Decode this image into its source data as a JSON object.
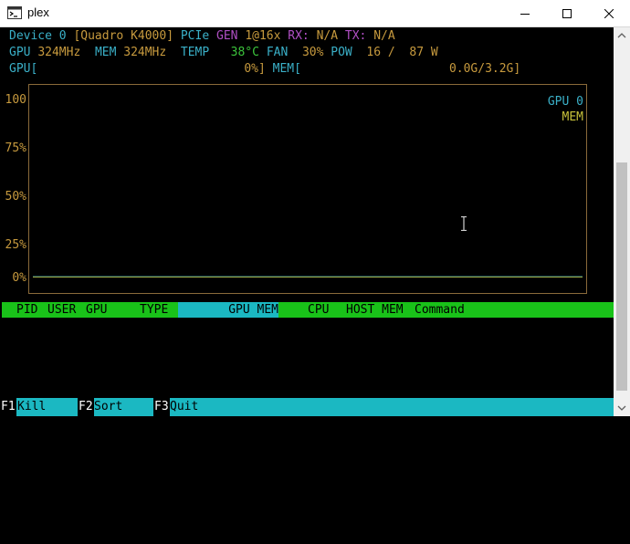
{
  "window": {
    "title": "plex",
    "minimize_icon": "minimize-icon",
    "maximize_icon": "maximize-icon",
    "close_icon": "close-icon"
  },
  "device": {
    "label": "Device 0",
    "name": "[Quadro K4000]",
    "pcie_label": "PCIe",
    "gen_label": "GEN",
    "gen_value": "1@16x",
    "rx_label": "RX:",
    "rx_value": "N/A",
    "tx_label": "TX:",
    "tx_value": "N/A"
  },
  "stats": {
    "gpu_clock_label": "GPU",
    "gpu_clock": "324MHz",
    "mem_clock_label": "MEM",
    "mem_clock": "324MHz",
    "temp_label": "TEMP",
    "temp_value": "38°C",
    "fan_label": "FAN",
    "fan_value": "30%",
    "pow_label": "POW",
    "pow_value": "16 /  87 W"
  },
  "usage": {
    "gpu_label": "GPU[",
    "gpu_value": "0%]",
    "mem_label": "MEM[",
    "mem_value": "0.0G/3.2G]",
    "gpu_util": 0,
    "mem_used_gb": 0.0,
    "mem_total_gb": 3.2
  },
  "chart_data": {
    "type": "line",
    "y_tick_labels": [
      "100",
      "75%",
      "50%",
      "25%",
      "0%"
    ],
    "ylim": [
      0,
      100
    ],
    "series": [
      {
        "name": "GPU 0",
        "color": "#3ab0c8",
        "values": [
          0,
          0
        ]
      },
      {
        "name": "MEM",
        "color": "#c8c23a",
        "values": [
          0,
          0
        ]
      }
    ],
    "legend_placement": "top-right"
  },
  "process_table": {
    "columns": [
      "PID",
      "USER",
      "GPU",
      "TYPE",
      "GPU MEM",
      "CPU",
      "HOST MEM",
      "Command"
    ],
    "selected_column": "GPU MEM",
    "rows": []
  },
  "function_keys": [
    {
      "key": "F1",
      "label": "Kill"
    },
    {
      "key": "F2",
      "label": "Sort"
    },
    {
      "key": "F3",
      "label": "Quit"
    }
  ],
  "colors": {
    "header_bar": "#19c219",
    "selected_column": "#1bb8c2",
    "function_bar": "#1bb8c2"
  }
}
